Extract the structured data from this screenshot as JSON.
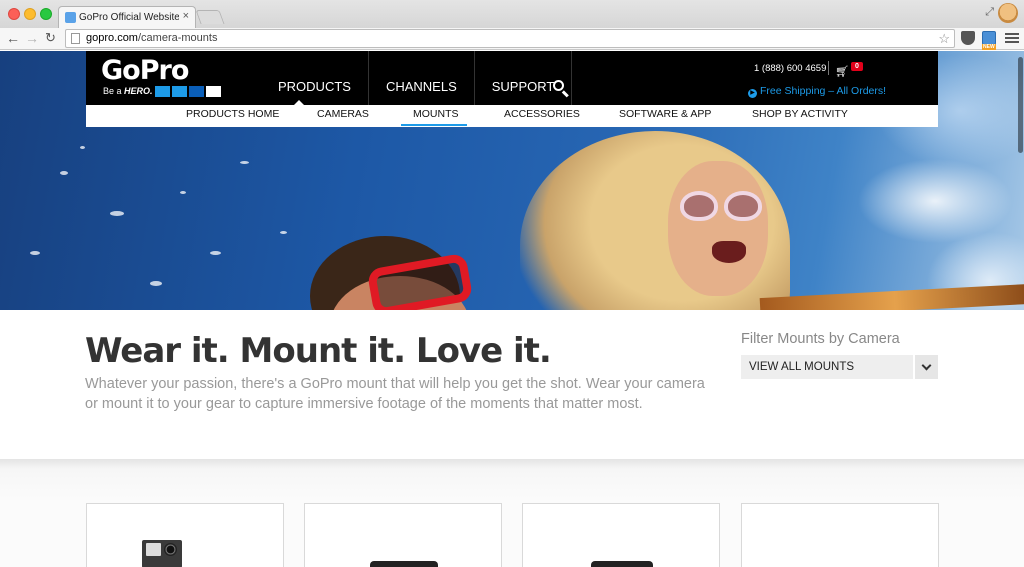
{
  "browser": {
    "tab_title": "GoPro Official Website: The",
    "tab_close": "×",
    "url_host": "gopro.com",
    "url_path": "/camera-mounts",
    "ext_badge": "NEW"
  },
  "header": {
    "logo_text": "GoPro",
    "tagline_pre": "Be a ",
    "tagline_hero": "HERO.",
    "nav": [
      "PRODUCTS",
      "CHANNELS",
      "SUPPORT"
    ],
    "phone": "1 (888) 600 4659",
    "cart_count": "0",
    "shipping": "Free Shipping – All Orders!"
  },
  "subnav": {
    "items": [
      "PRODUCTS HOME",
      "CAMERAS",
      "MOUNTS",
      "ACCESSORIES",
      "SOFTWARE & APP",
      "SHOP BY ACTIVITY"
    ],
    "active": "MOUNTS"
  },
  "intro": {
    "headline": "Wear it. Mount it. Love it.",
    "description": "Whatever your passion, there's a GoPro mount that will help you get the shot. Wear your camera or mount it to your gear to capture immersive footage of the moments that matter most.",
    "filter_label": "Filter Mounts by Camera",
    "filter_value": "VIEW ALL MOUNTS"
  },
  "colors": {
    "accent": "#1d9be8",
    "cart_badge": "#e2001a",
    "header_bg": "#000000"
  }
}
